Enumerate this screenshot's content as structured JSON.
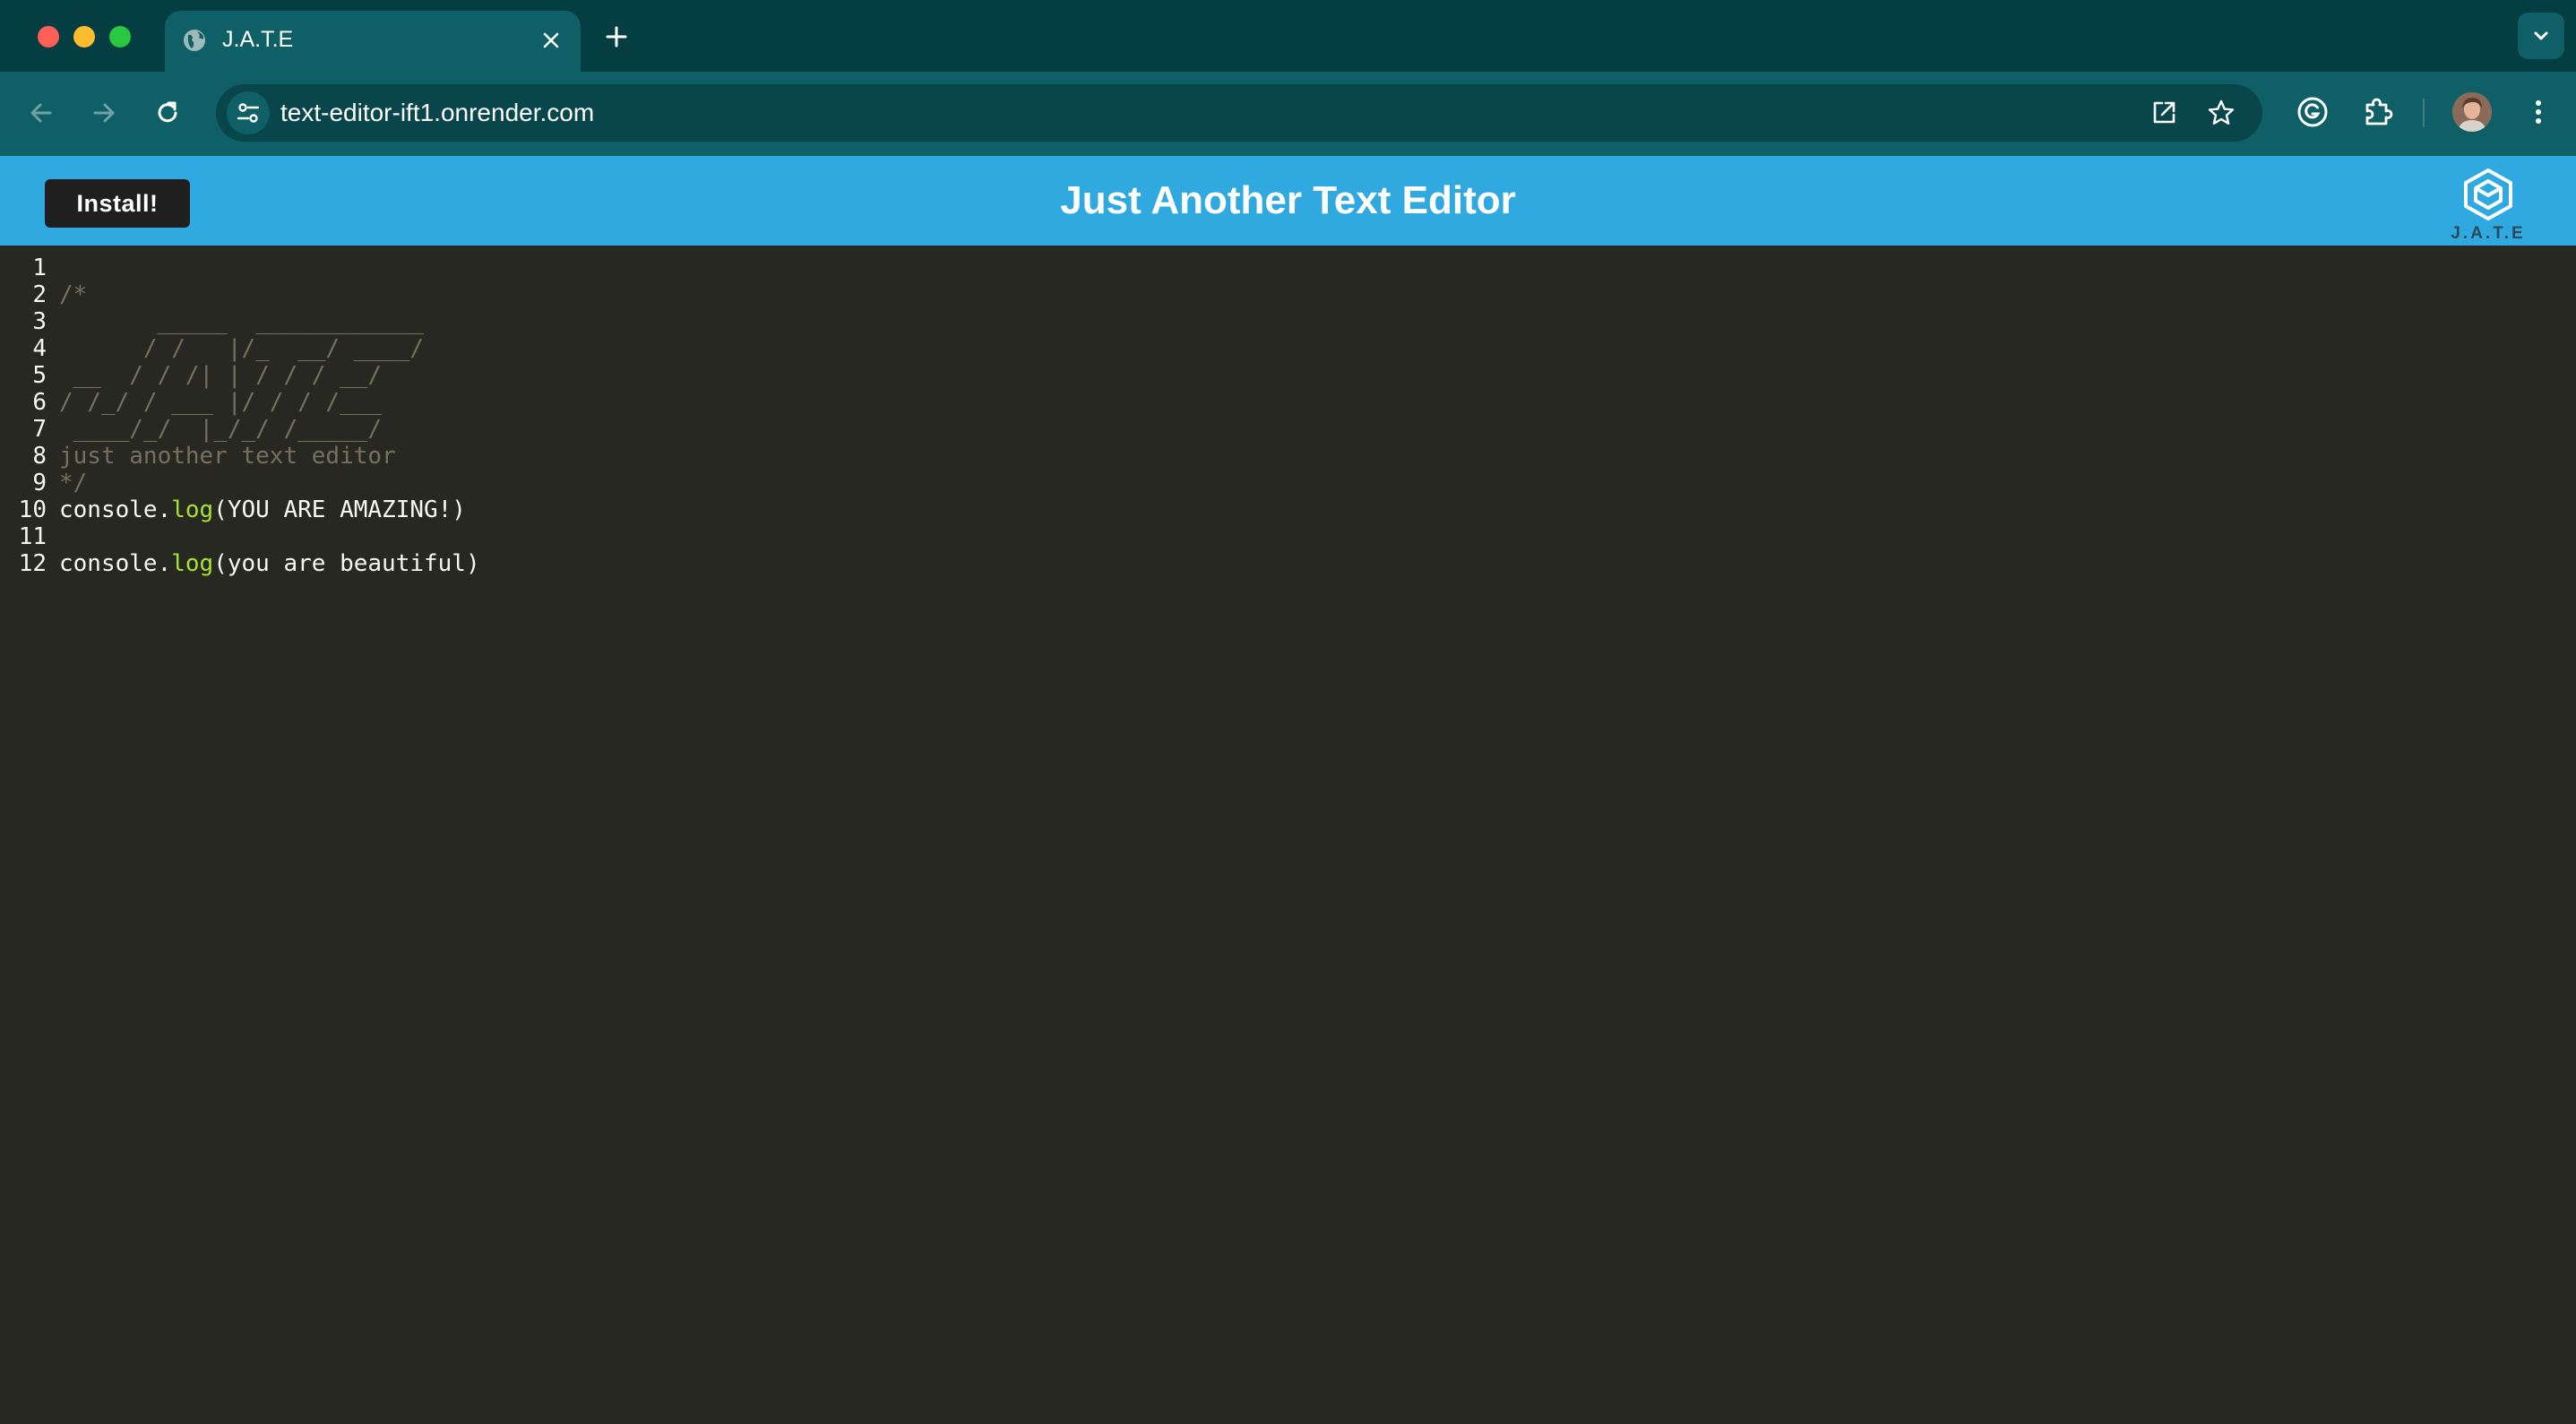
{
  "browser": {
    "tab": {
      "title": "J.A.T.E",
      "favicon": "globe-icon"
    },
    "url": "text-editor-ift1.onrender.com",
    "colors": {
      "tabstrip": "#043d42",
      "toolbar": "#0f6066"
    }
  },
  "app": {
    "install_label": "Install!",
    "title": "Just Another Text Editor",
    "logo_text": "J.A.T.E",
    "header_color": "#30a9e0"
  },
  "editor": {
    "lines": [
      {
        "num": "1",
        "parts": []
      },
      {
        "num": "2",
        "parts": [
          {
            "t": "/*",
            "c": "comment"
          }
        ]
      },
      {
        "num": "3",
        "parts": [
          {
            "t": "       _____  ____________",
            "c": "comment"
          }
        ]
      },
      {
        "num": "4",
        "parts": [
          {
            "t": "      / /   |/_  __/ ____/",
            "c": "comment"
          }
        ]
      },
      {
        "num": "5",
        "parts": [
          {
            "t": " __  / / /| | / / / __/",
            "c": "comment"
          }
        ]
      },
      {
        "num": "6",
        "parts": [
          {
            "t": "/ /_/ / ___ |/ / / /___",
            "c": "comment"
          }
        ]
      },
      {
        "num": "7",
        "parts": [
          {
            "t": " ____/_/  |_/_/ /_____/",
            "c": "comment"
          }
        ]
      },
      {
        "num": "8",
        "parts": [
          {
            "t": "just another text editor",
            "c": "comment"
          }
        ]
      },
      {
        "num": "9",
        "parts": [
          {
            "t": "*/",
            "c": "comment"
          }
        ]
      },
      {
        "num": "10",
        "parts": [
          {
            "t": "console.",
            "c": "plain"
          },
          {
            "t": "log",
            "c": "fn"
          },
          {
            "t": "(YOU ARE AMAZING!)",
            "c": "plain"
          }
        ]
      },
      {
        "num": "11",
        "parts": []
      },
      {
        "num": "12",
        "parts": [
          {
            "t": "console.",
            "c": "plain"
          },
          {
            "t": "log",
            "c": "fn"
          },
          {
            "t": "(you are beautiful)",
            "c": "plain"
          }
        ]
      }
    ],
    "colors": {
      "background": "#272822",
      "comment": "#75715e",
      "function": "#a6e22e",
      "text": "#f8f8f2"
    }
  }
}
